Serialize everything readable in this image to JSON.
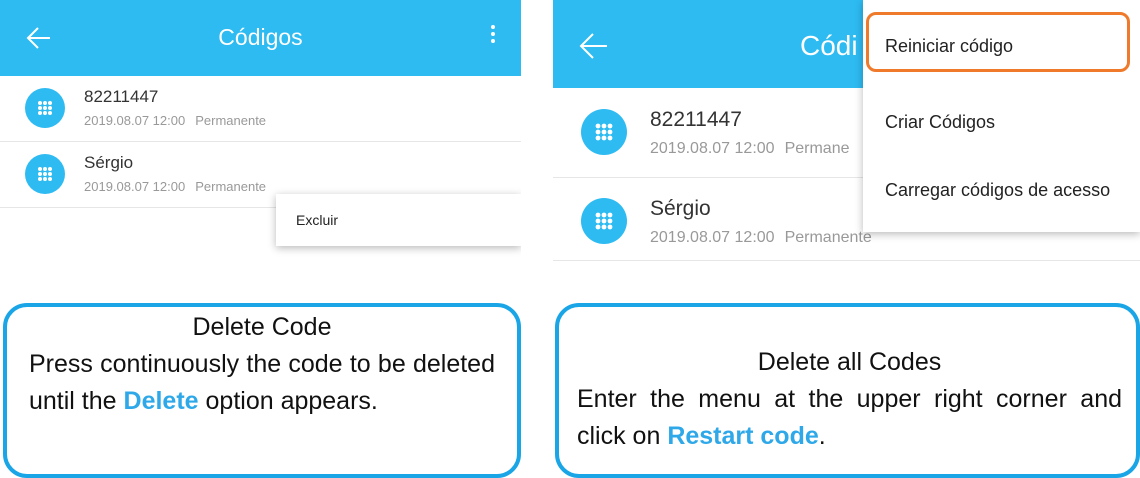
{
  "colors": {
    "accent": "#2dbbf2",
    "callout_border": "#1aa5e6",
    "highlight_border": "#ef7a2c",
    "keyword": "#2ea8e8"
  },
  "left_screen": {
    "header": {
      "title": "Códigos",
      "back_icon": "back-arrow-icon",
      "menu_icon": "more-vertical-icon"
    },
    "items": [
      {
        "name": "82211447",
        "date": "2019.08.07 12:00",
        "status": "Permanente"
      },
      {
        "name": "Sérgio",
        "date": "2019.08.07 12:00",
        "status": "Permanente"
      }
    ],
    "popup": {
      "delete_label": "Excluir"
    }
  },
  "right_screen": {
    "header": {
      "title": "Códi",
      "back_icon": "back-arrow-icon"
    },
    "items": [
      {
        "name": "82211447",
        "date": "2019.08.07 12:00",
        "status": "Permane"
      },
      {
        "name": "Sérgio",
        "date": "2019.08.07 12:00",
        "status": "Permanente"
      }
    ],
    "menu": [
      "Reiniciar código",
      "Criar Códigos",
      "Carregar códigos de acesso"
    ]
  },
  "callouts": {
    "left": {
      "title": "Delete Code",
      "body_before": "Press continuously the code to be deleted until the ",
      "keyword": "Delete",
      "body_after": " option appears."
    },
    "right": {
      "title": "Delete all Codes",
      "body_before": "Enter the menu at the upper right corner and click on ",
      "keyword": "Restart code",
      "body_after": "."
    }
  }
}
